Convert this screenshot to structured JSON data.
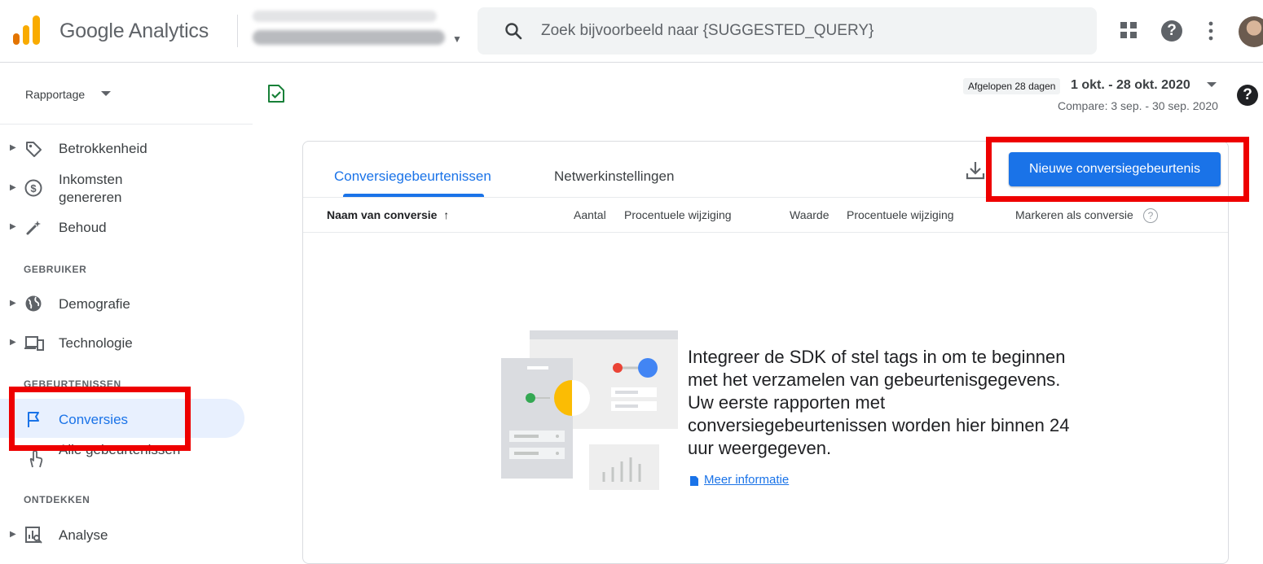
{
  "header": {
    "app_title": "Google Analytics",
    "search_placeholder": "Zoek bijvoorbeeld naar {SUGGESTED_QUERY}"
  },
  "sidebar": {
    "report_selector": "Rapportage",
    "items_top": [
      {
        "label": "Betrokkenheid",
        "icon": "tag-icon"
      },
      {
        "label": "Inkomsten genereren",
        "icon": "dollar-icon"
      },
      {
        "label": "Behoud",
        "icon": "magic-wand-icon"
      }
    ],
    "section_user": "GEBRUIKER",
    "items_user": [
      {
        "label": "Demografie",
        "icon": "globe-icon"
      },
      {
        "label": "Technologie",
        "icon": "devices-icon"
      }
    ],
    "section_events": "GEBEURTENISSEN",
    "items_events": [
      {
        "label": "Conversies",
        "icon": "flag-icon",
        "active": true
      },
      {
        "label": "Alle gebeurtenissen",
        "icon": "touch-icon"
      }
    ],
    "section_explore": "ONTDEKKEN",
    "items_explore": [
      {
        "label": "Analyse",
        "icon": "analysis-icon"
      }
    ]
  },
  "date": {
    "chip": "Afgelopen 28 dagen",
    "range": "1 okt. - 28 okt. 2020",
    "compare": "Compare: 3 sep. - 30 sep. 2020"
  },
  "card": {
    "tabs": [
      "Conversiegebeurtenissen",
      "Netwerkinstellingen"
    ],
    "new_button": "Nieuwe conversiegebeurtenis",
    "columns": {
      "name": "Naam van conversie",
      "count": "Aantal",
      "pct1": "Procentuele wijziging",
      "value": "Waarde",
      "pct2": "Procentuele wijziging",
      "mark": "Markeren als conversie"
    },
    "empty_message": "Integreer de SDK of stel tags in om te beginnen met het verzamelen van gebeurtenisgegevens. Uw eerste rapporten met conversiegebeurtenissen worden hier binnen 24 uur weergegeven.",
    "more_link": "Meer informatie"
  },
  "colors": {
    "accent": "#1a73e8",
    "highlight": "#ee0000"
  }
}
